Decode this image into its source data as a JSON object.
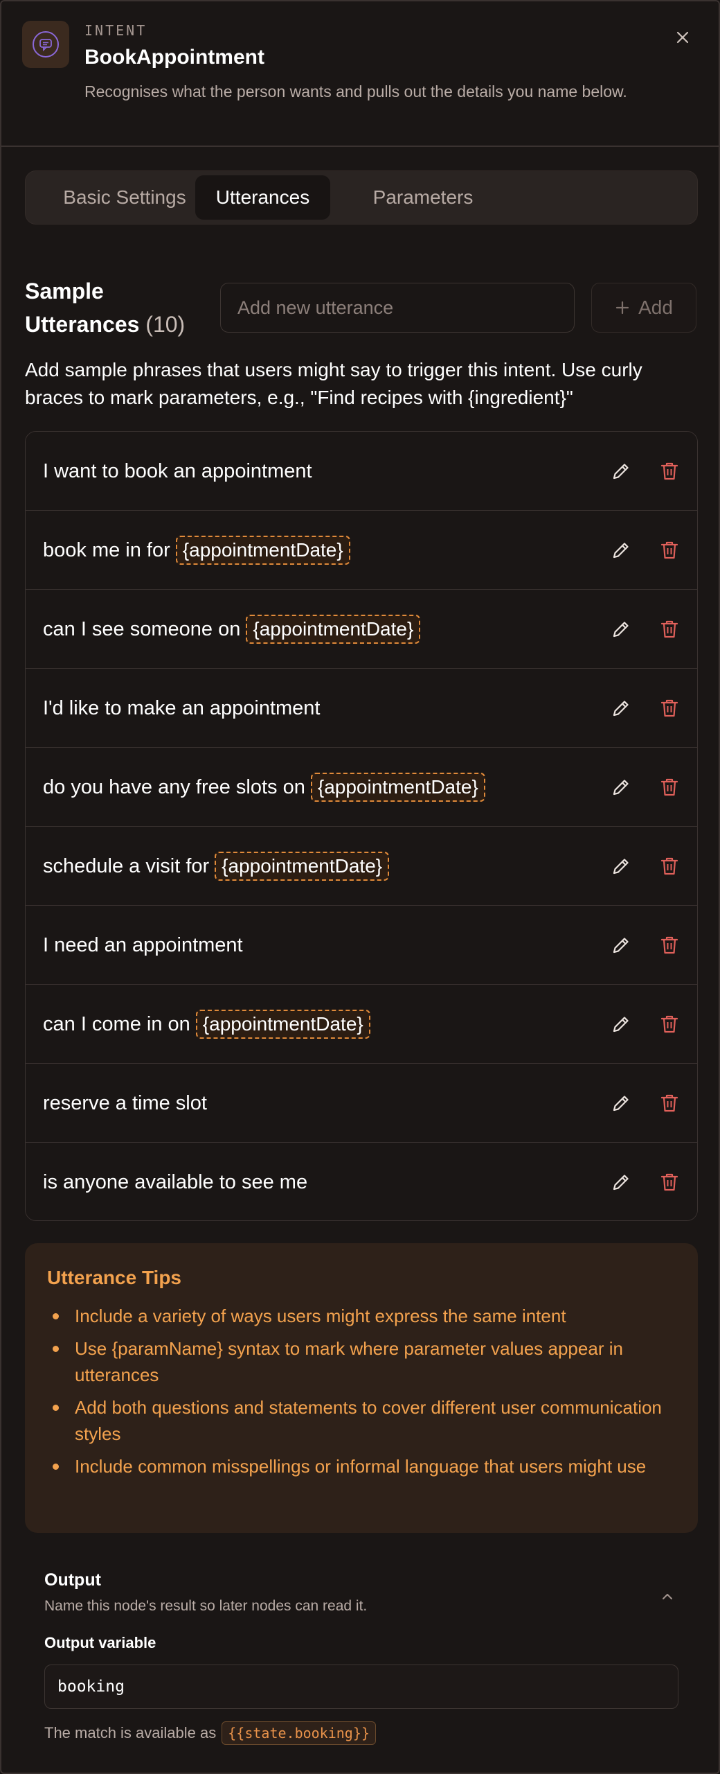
{
  "header": {
    "eyebrow": "INTENT",
    "title": "BookAppointment",
    "description": "Recognises what the person wants and pulls out the details you name below.",
    "icon": "message-icon",
    "close_icon": "close-icon"
  },
  "tabs": [
    {
      "label": "Basic Settings",
      "active": false
    },
    {
      "label": "Utterances",
      "active": true
    },
    {
      "label": "Parameters",
      "active": false
    }
  ],
  "utterances_section": {
    "title": "Sample Utterances",
    "count": "(10)",
    "input_placeholder": "Add new utterance",
    "input_value": "",
    "add_label": "Add",
    "help_text": "Add sample phrases that users might say to trigger this intent. Use curly braces to mark parameters, e.g., \"Find recipes with {ingredient}\""
  },
  "utterances": [
    {
      "text": "I want to book an appointment",
      "param": ""
    },
    {
      "text": "book me in for",
      "param": "{appointmentDate}"
    },
    {
      "text": "can I see someone on",
      "param": "{appointmentDate}"
    },
    {
      "text": "I'd like to make an appointment",
      "param": ""
    },
    {
      "text": "do you have any free slots on",
      "param": "{appointmentDate}"
    },
    {
      "text": "schedule a visit for",
      "param": "{appointmentDate}"
    },
    {
      "text": "I need an appointment",
      "param": ""
    },
    {
      "text": "can I come in on",
      "param": "{appointmentDate}"
    },
    {
      "text": "reserve a time slot",
      "param": ""
    },
    {
      "text": "is anyone available to see me",
      "param": ""
    }
  ],
  "tips": {
    "title": "Utterance Tips",
    "items": [
      "Include a variety of ways users might express the same intent",
      "Use {paramName} syntax to mark where parameter values appear in utterances",
      "Add both questions and statements to cover different user communication styles",
      "Include common misspellings or informal language that users might use"
    ]
  },
  "output": {
    "title": "Output",
    "description": "Name this node's result so later nodes can read it.",
    "variable_label": "Output variable",
    "variable_value": "booking",
    "note_prefix": "The match is available as",
    "note_code": "{{state.booking}}"
  },
  "colors": {
    "accent": "#e08a3a",
    "tips_text": "#f3a24e",
    "delete": "#e0605a",
    "background": "#1a1615"
  }
}
